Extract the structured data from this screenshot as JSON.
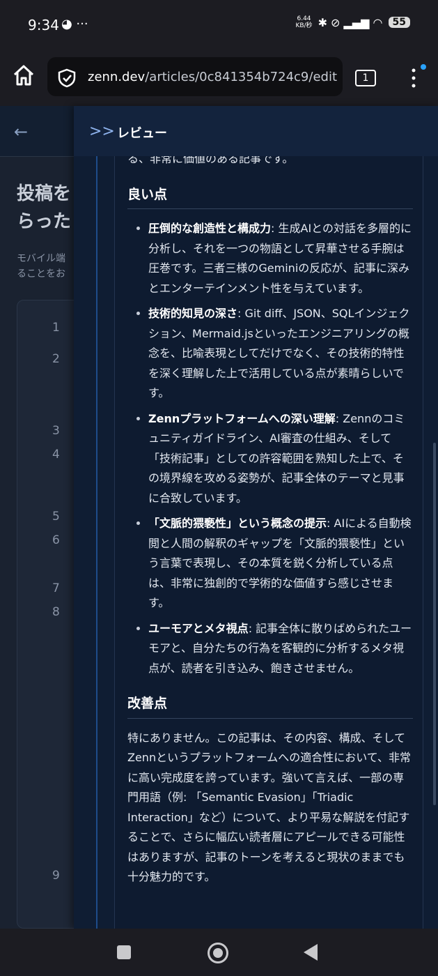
{
  "status_bar": {
    "time": "9:34",
    "left_icons": "◕ ···",
    "speed_top": "6.44",
    "speed_unit": "KB/秒",
    "signal_icons": "✱ ⊘ ▂▄▆ ◠",
    "battery": "55"
  },
  "browser": {
    "url_domain": "zenn.dev",
    "url_path": "/articles/0c841354b724c9/edit",
    "tab_count": "1"
  },
  "background_page": {
    "title_line1": "投稿を",
    "title_line2": "らった",
    "sub_line1": "モバイル端",
    "sub_line2": "ることをお",
    "line_numbers": [
      "1",
      "2",
      "3",
      "4",
      "5",
      "6",
      "7",
      "8",
      "9"
    ]
  },
  "panel": {
    "title": "レビュー",
    "cut_text": "る、非常に価値のある記事です。",
    "good_heading": "良い点",
    "good_points": [
      {
        "title": "圧倒的な創造性と構成力",
        "text": ": 生成AIとの対話を多層的に分析し、それを一つの物語として昇華させる手腕は圧巻です。三者三様のGeminiの反応が、記事に深みとエンターテインメント性を与えています。"
      },
      {
        "title": "技術的知見の深さ",
        "text": ": Git diff、JSON、SQLインジェクション、Mermaid.jsといったエンジニアリングの概念を、比喩表現としてだけでなく、その技術的特性を深く理解した上で活用している点が素晴らしいです。"
      },
      {
        "title": "Zennプラットフォームへの深い理解",
        "text": ": Zennのコミュニティガイドライン、AI審査の仕組み、そして「技術記事」としての許容範囲を熟知した上で、その境界線を攻める姿勢が、記事全体のテーマと見事に合致しています。"
      },
      {
        "title": "「文脈的猥褻性」という概念の提示",
        "text": ": AIによる自動検閲と人間の解釈のギャップを「文脈的猥褻性」という言葉で表現し、その本質を鋭く分析している点は、非常に独創的で学術的な価値すら感じさせます。"
      },
      {
        "title": "ユーモアとメタ視点",
        "text": ": 記事全体に散りばめられたユーモアと、自分たちの行為を客観的に分析するメタ視点が、読者を引き込み、飽きさせません。"
      }
    ],
    "improve_heading": "改善点",
    "improve_text": "特にありません。この記事は、その内容、構成、そしてZennというプラットフォームへの適合性において、非常に高い完成度を誇っています。強いて言えば、一部の専門用語（例: 「Semantic Evasion」「Triadic Interaction」など）について、より平易な解説を付記することで、さらに幅広い読者層にアピールできる可能性はありますが、記事のトーンを考えると現状のままでも十分魅力的です。"
  }
}
